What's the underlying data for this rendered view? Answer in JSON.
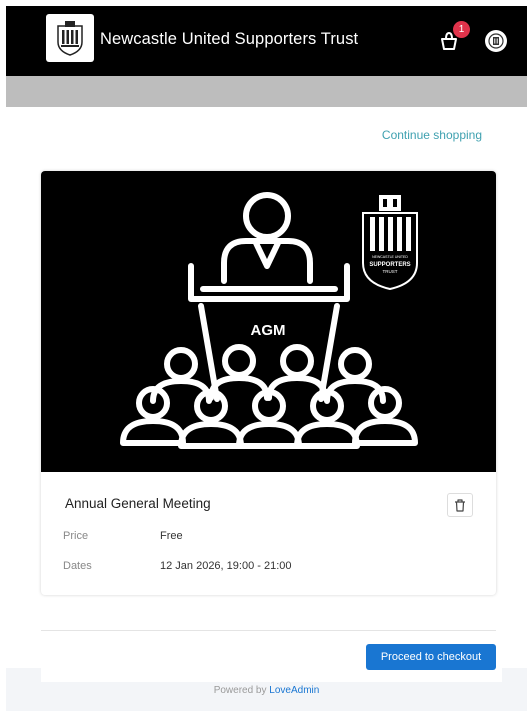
{
  "header": {
    "title": "Newcastle United Supporters Trust",
    "cart_count": "1"
  },
  "colors": {
    "header_bg": "#000000",
    "accent": "#1976d2",
    "link": "#3fa1b0",
    "badge": "#e0334b"
  },
  "links": {
    "continue_shopping": "Continue shopping"
  },
  "item": {
    "image_text": "AGM",
    "logo_text_top": "NEWCASTLE UNITED",
    "logo_text_main": "SUPPORTERS",
    "logo_text_sub": "TRUST",
    "title": "Annual General Meeting",
    "price_label": "Price",
    "price_value": "Free",
    "dates_label": "Dates",
    "dates_value": "12 Jan 2026, 19:00 - 21:00"
  },
  "actions": {
    "checkout": "Proceed to checkout"
  },
  "footer": {
    "powered_by": "Powered by",
    "brand": "LoveAdmin"
  },
  "icons": [
    "crest-logo-icon",
    "cart-icon",
    "avatar-icon",
    "trash-icon"
  ]
}
